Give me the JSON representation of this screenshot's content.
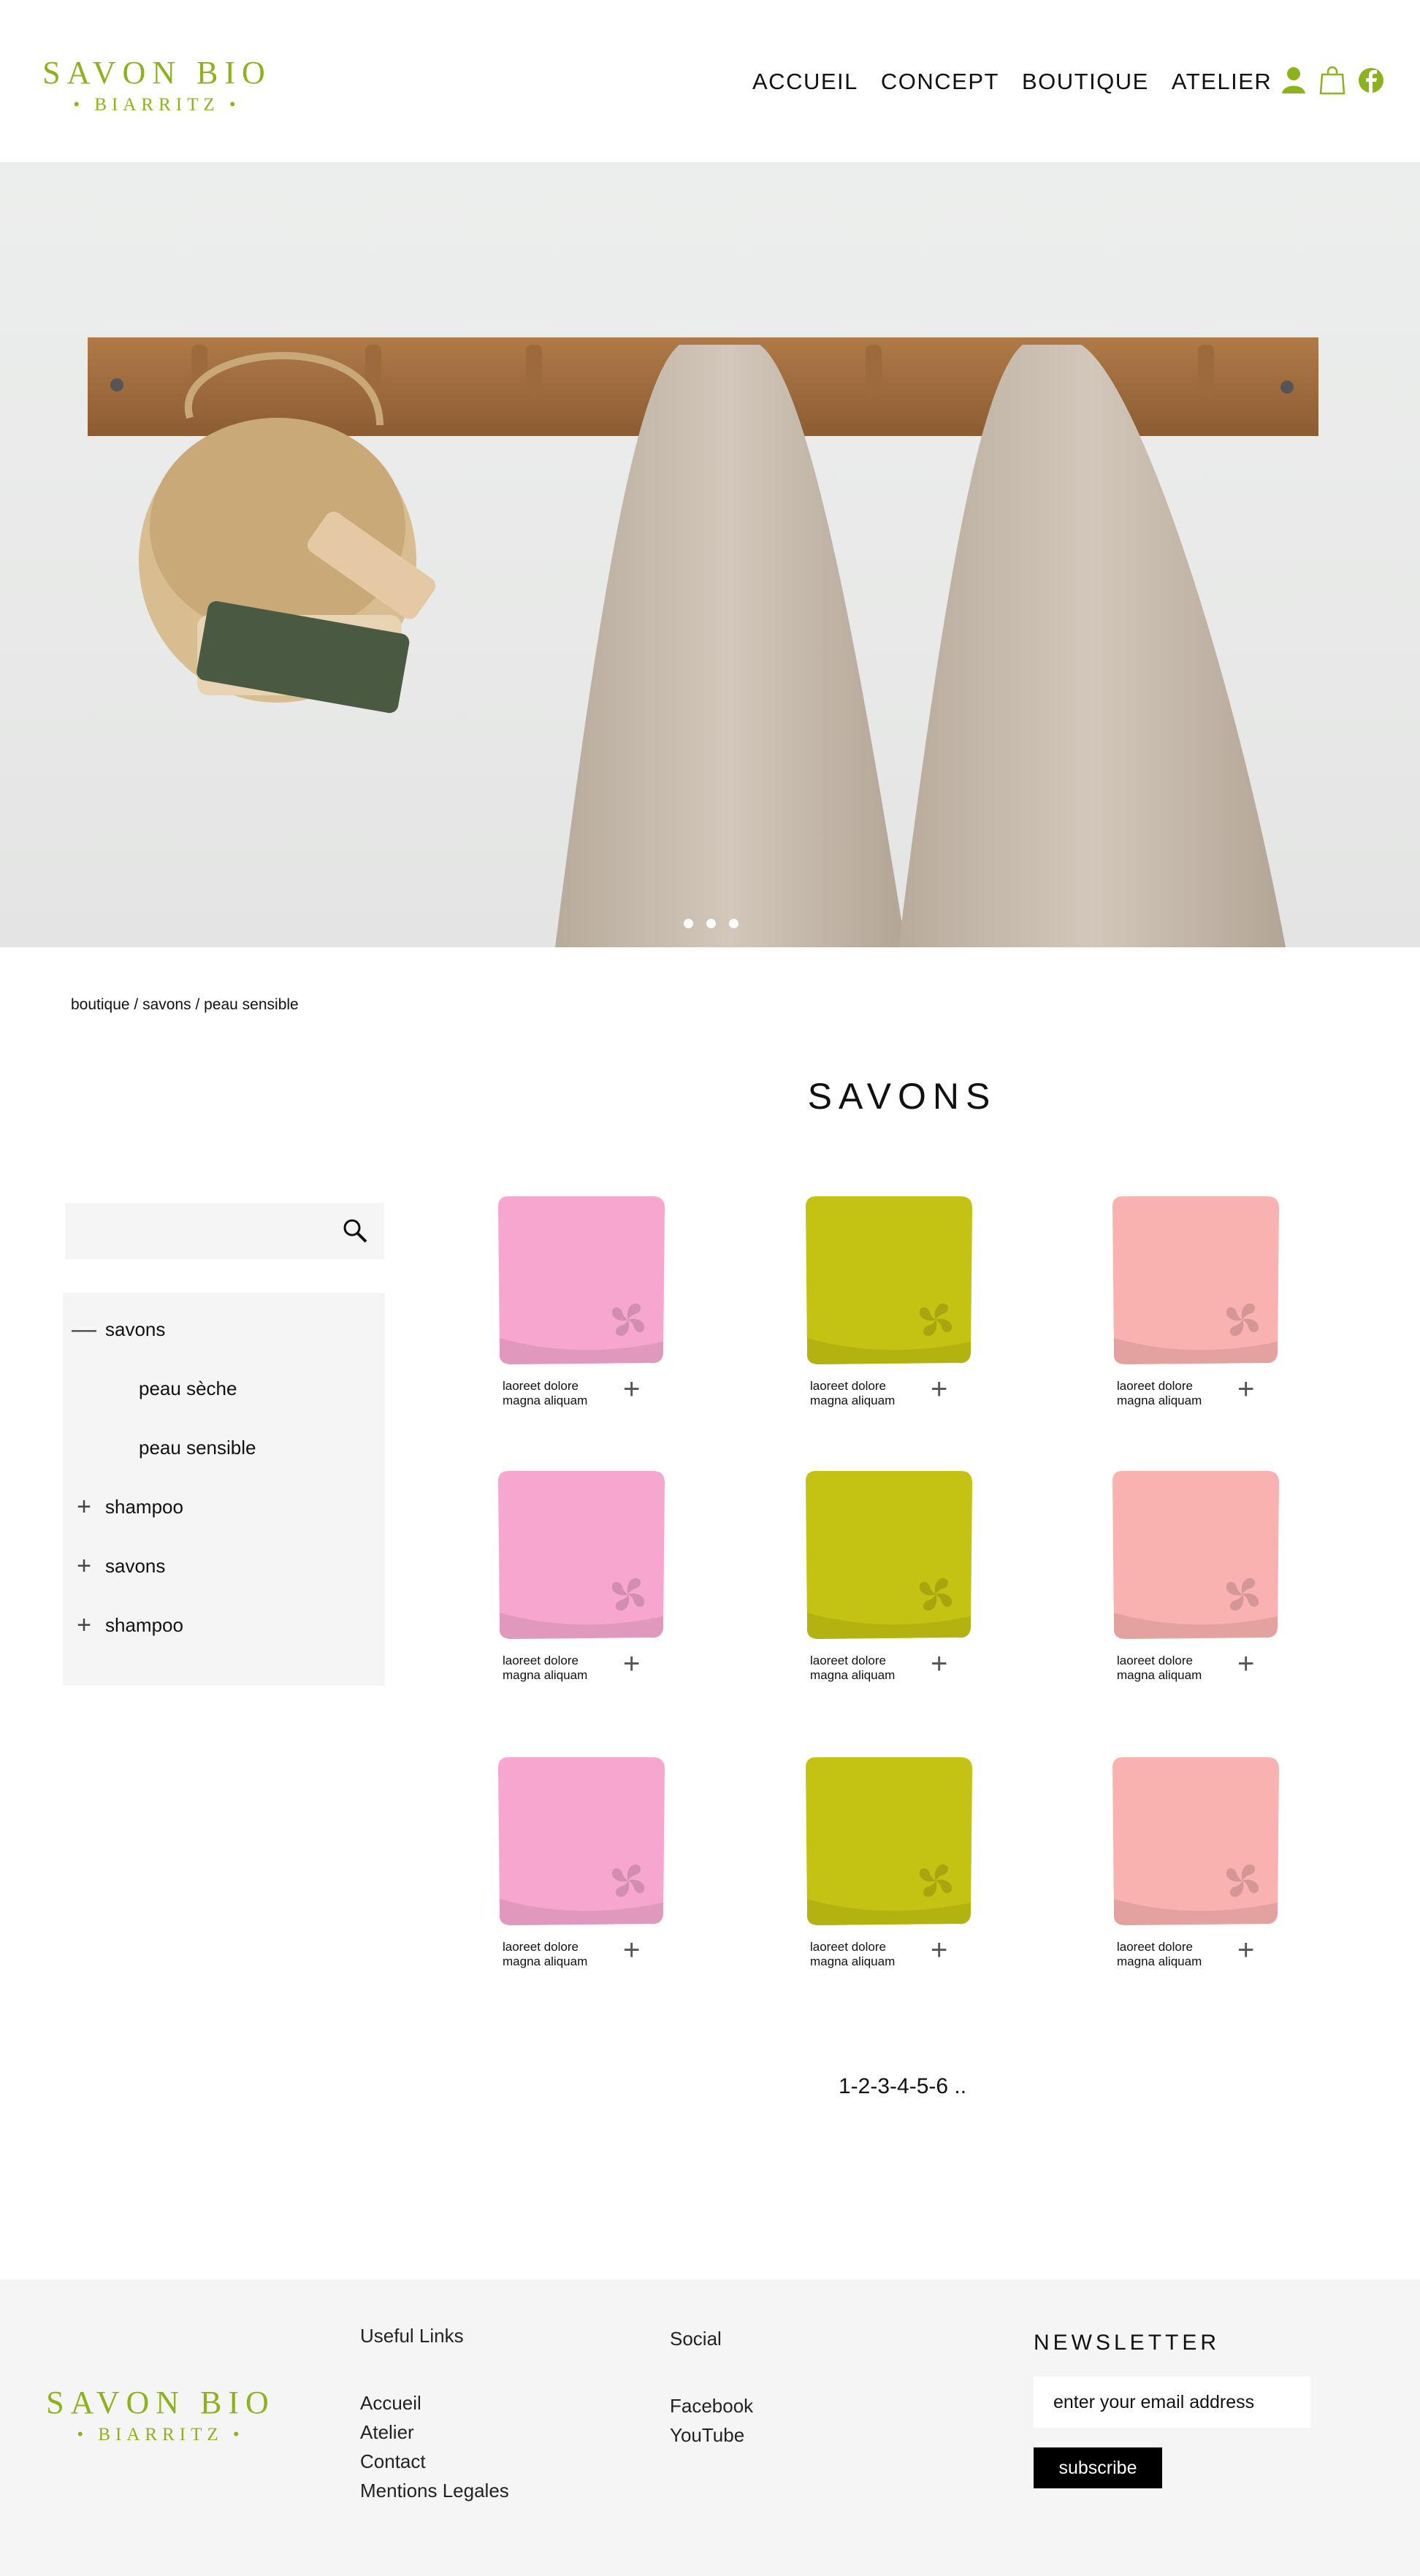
{
  "logo": {
    "line1": "SAVON BIO",
    "line2": "• BIARRITZ •"
  },
  "nav": [
    "ACCUEIL",
    "CONCEPT",
    "BOUTIQUE",
    "ATELIER"
  ],
  "icons": [
    "user-icon",
    "shopping-bag-icon",
    "facebook-icon"
  ],
  "colors": {
    "brand": "#8cb31b",
    "pink": "#f7a7cf",
    "olive": "#c4c313",
    "salmon": "#f9b2b0",
    "panel": "#f5f5f5"
  },
  "breadcrumb": "boutique / savons / peau sensible",
  "page_title": "SAVONS",
  "categories": [
    {
      "symbol": "—",
      "label": "savons",
      "level": 0
    },
    {
      "symbol": "",
      "label": "peau sèche",
      "level": 1
    },
    {
      "symbol": "",
      "label": "peau sensible",
      "level": 1
    },
    {
      "symbol": "+",
      "label": "shampoo",
      "level": 0
    },
    {
      "symbol": "+",
      "label": "savons",
      "level": 0
    },
    {
      "symbol": "+",
      "label": "shampoo",
      "level": 0
    }
  ],
  "products": [
    {
      "line1": "laoreet dolore",
      "line2": "magna aliquam",
      "color": "pink"
    },
    {
      "line1": "laoreet dolore",
      "line2": "magna aliquam",
      "color": "olive"
    },
    {
      "line1": "laoreet dolore",
      "line2": "magna aliquam",
      "color": "salmon"
    },
    {
      "line1": "laoreet dolore",
      "line2": "magna aliquam",
      "color": "pink"
    },
    {
      "line1": "laoreet dolore",
      "line2": "magna aliquam",
      "color": "olive"
    },
    {
      "line1": "laoreet dolore",
      "line2": "magna aliquam",
      "color": "salmon"
    },
    {
      "line1": "laoreet dolore",
      "line2": "magna aliquam",
      "color": "pink"
    },
    {
      "line1": "laoreet dolore",
      "line2": "magna aliquam",
      "color": "olive"
    },
    {
      "line1": "laoreet dolore",
      "line2": "magna aliquam",
      "color": "salmon"
    }
  ],
  "add_symbol": "+",
  "pagination": "1-2-3-4-5-6 ..",
  "footer": {
    "useful_title": "Useful Links",
    "useful_links": [
      "Accueil",
      "Atelier",
      "Contact",
      "Mentions Legales"
    ],
    "social_title": "Social",
    "social_links": [
      "Facebook",
      "YouTube"
    ],
    "newsletter_title": "NEWSLETTER",
    "email_placeholder": "enter your email address",
    "subscribe_label": "subscribe"
  }
}
